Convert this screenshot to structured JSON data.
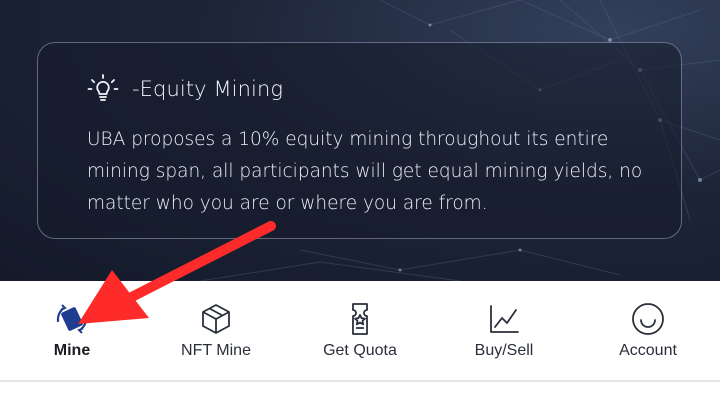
{
  "card": {
    "icon": "lightbulb-icon",
    "title": "-Equity Mining",
    "body": "UBA proposes a 10% equity mining throughout its entire mining span, all participants will get equal mining yields, no matter who you are or where you are from."
  },
  "nav": {
    "tabs": [
      {
        "label": "Mine",
        "icon": "mine-sync-icon",
        "active": true
      },
      {
        "label": "NFT Mine",
        "icon": "cube-icon",
        "active": false
      },
      {
        "label": "Get Quota",
        "icon": "ticket-icon",
        "active": false
      },
      {
        "label": "Buy/Sell",
        "icon": "chart-line-icon",
        "active": false
      },
      {
        "label": "Account",
        "icon": "smiley-icon",
        "active": false
      }
    ]
  },
  "annotation": {
    "type": "red-arrow",
    "color": "#ff2a2a",
    "points_to": "Mine"
  },
  "colors": {
    "hero_bg": "#1d2538",
    "annotation": "#ff2a2a",
    "active_icon": "#1f3e8f"
  }
}
